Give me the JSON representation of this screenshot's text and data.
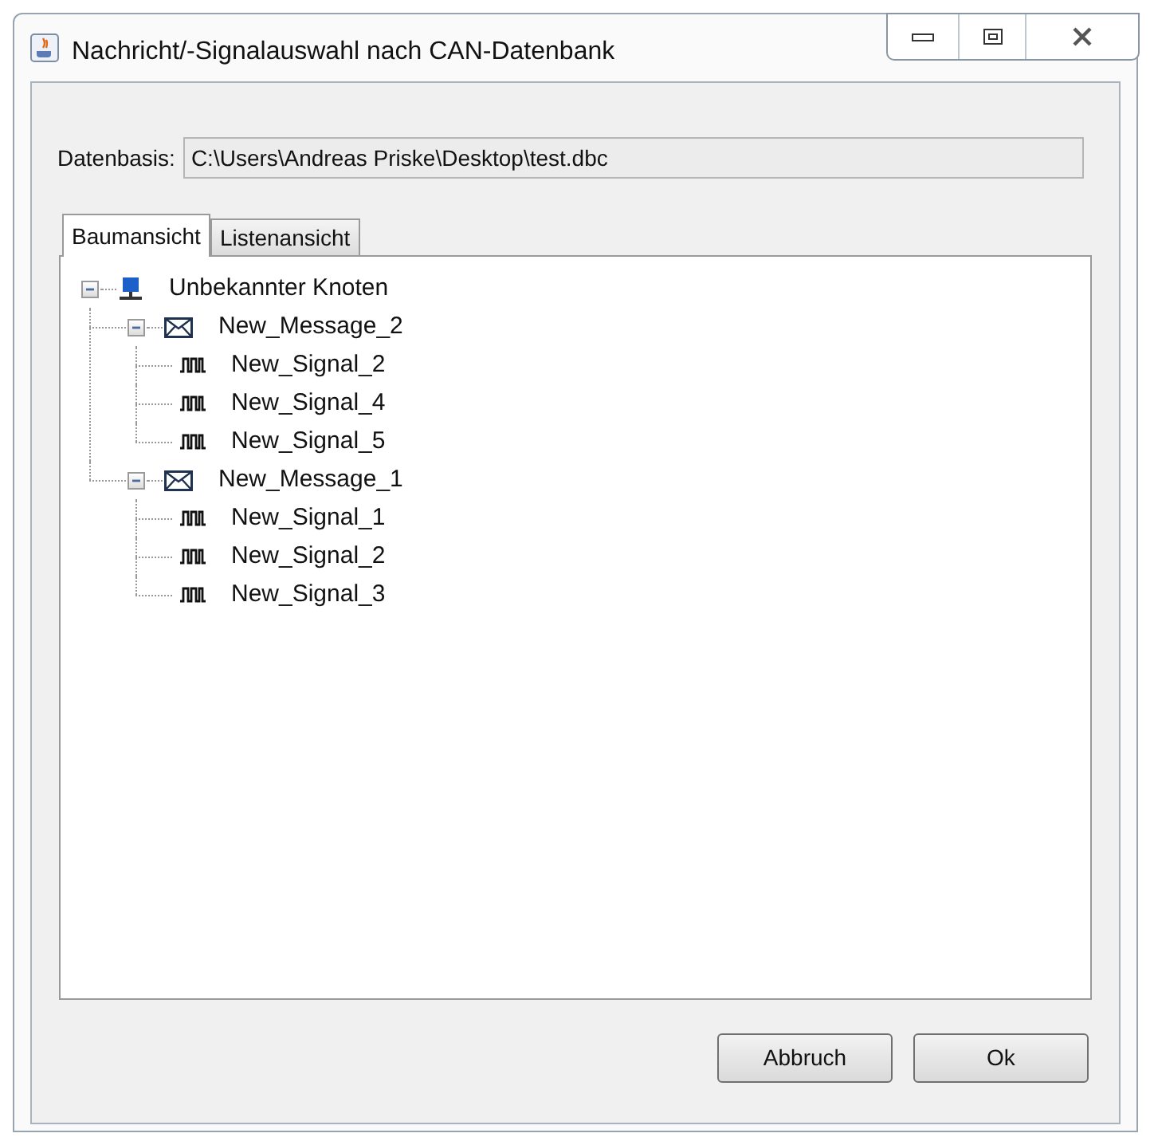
{
  "window": {
    "title": "Nachricht/-Signalauswahl nach CAN-Datenbank"
  },
  "database": {
    "label": "Datenbasis:",
    "value": "C:\\Users\\Andreas Priske\\Desktop\\test.dbc"
  },
  "tabs": [
    {
      "label": "Baumansicht",
      "selected": true
    },
    {
      "label": "Listenansicht",
      "selected": false
    }
  ],
  "tree": [
    {
      "kind": "node",
      "label": "Unbekannter Knoten",
      "expanded": true,
      "children": [
        {
          "kind": "message",
          "label": "New_Message_2",
          "expanded": true,
          "children": [
            {
              "kind": "signal",
              "label": "New_Signal_2"
            },
            {
              "kind": "signal",
              "label": "New_Signal_4"
            },
            {
              "kind": "signal",
              "label": "New_Signal_5"
            }
          ]
        },
        {
          "kind": "message",
          "label": "New_Message_1",
          "expanded": true,
          "children": [
            {
              "kind": "signal",
              "label": "New_Signal_1"
            },
            {
              "kind": "signal",
              "label": "New_Signal_2"
            },
            {
              "kind": "signal",
              "label": "New_Signal_3"
            }
          ]
        }
      ]
    }
  ],
  "buttons": [
    "Abbruch",
    "Ok"
  ]
}
